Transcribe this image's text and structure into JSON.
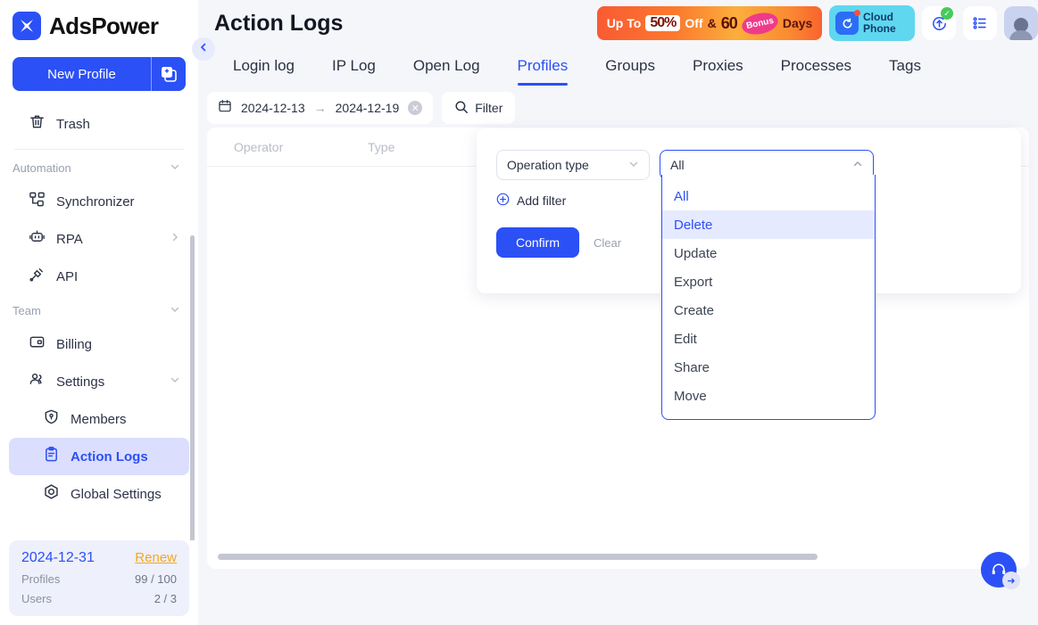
{
  "brand": {
    "name": "AdsPower",
    "logo_icon": "adspower-logo-icon"
  },
  "sidebar": {
    "new_profile_label": "New Profile",
    "new_profile_add_icon": "add-profile-icon",
    "items": [
      {
        "label": "Trash",
        "icon": "trash-icon",
        "type": "item"
      },
      {
        "label": "Automation",
        "icon": "chevron-down-icon",
        "type": "group"
      },
      {
        "label": "Synchronizer",
        "icon": "synchronizer-icon",
        "type": "item"
      },
      {
        "label": "RPA",
        "icon": "rpa-robot-icon",
        "type": "item",
        "chevron": "chevron-right-icon"
      },
      {
        "label": "API",
        "icon": "api-icon",
        "type": "item"
      },
      {
        "label": "Team",
        "icon": "chevron-down-icon",
        "type": "group"
      },
      {
        "label": "Billing",
        "icon": "billing-icon",
        "type": "item"
      },
      {
        "label": "Settings",
        "icon": "team-settings-icon",
        "type": "item",
        "chevron": "chevron-down-icon"
      },
      {
        "label": "Members",
        "icon": "members-shield-icon",
        "type": "sub"
      },
      {
        "label": "Action Logs",
        "icon": "action-logs-icon",
        "type": "sub",
        "active": true
      },
      {
        "label": "Global Settings",
        "icon": "global-settings-icon",
        "type": "sub"
      }
    ],
    "plan": {
      "expiry_date": "2024-12-31",
      "renew_label": "Renew",
      "rows": [
        {
          "key": "Profiles",
          "value": "99 / 100"
        },
        {
          "key": "Users",
          "value": "2 / 3"
        }
      ]
    },
    "collapse_icon": "chevron-left-icon"
  },
  "header": {
    "title": "Action Logs",
    "promo": {
      "up_to": "Up To",
      "percent": "50%",
      "off": "Off",
      "amp": "&",
      "days_count": "60",
      "bonus": "Bonus",
      "days": "Days"
    },
    "cloud_phone": {
      "line1": "Cloud",
      "line2": "Phone",
      "icon": "cloud-phone-icon"
    },
    "icons": [
      {
        "name": "update-icon",
        "badge": "check-badge"
      },
      {
        "name": "task-list-icon"
      },
      {
        "name": "avatar"
      }
    ]
  },
  "tabs": [
    {
      "label": "Login log",
      "active": false
    },
    {
      "label": "IP Log",
      "active": false
    },
    {
      "label": "Open Log",
      "active": false
    },
    {
      "label": "Profiles",
      "active": true
    },
    {
      "label": "Groups",
      "active": false
    },
    {
      "label": "Proxies",
      "active": false
    },
    {
      "label": "Processes",
      "active": false
    },
    {
      "label": "Tags",
      "active": false
    }
  ],
  "filter_bar": {
    "calendar_icon": "calendar-icon",
    "date_start": "2024-12-13",
    "date_arrow": "→",
    "date_end": "2024-12-19",
    "clear_icon": "clear-circle-icon",
    "search_icon": "search-icon",
    "filter_label": "Filter"
  },
  "table": {
    "columns": [
      "Operator",
      "Type"
    ],
    "rows": []
  },
  "filter_popover": {
    "field_label": "Operation type",
    "field_chevron": "chevron-down-icon",
    "value_label": "All",
    "value_chevron": "chevron-up-icon",
    "add_filter_label": "Add filter",
    "add_filter_icon": "plus-circle-icon",
    "confirm_label": "Confirm",
    "clear_label": "Clear",
    "dropdown_options": [
      {
        "label": "All",
        "state": "selected"
      },
      {
        "label": "Delete",
        "state": "highlight"
      },
      {
        "label": "Update",
        "state": "normal"
      },
      {
        "label": "Export",
        "state": "normal"
      },
      {
        "label": "Create",
        "state": "normal"
      },
      {
        "label": "Edit",
        "state": "normal"
      },
      {
        "label": "Share",
        "state": "normal"
      },
      {
        "label": "Move",
        "state": "normal"
      }
    ]
  },
  "support": {
    "icon": "headset-support-icon",
    "arrow_icon": "arrow-right-icon"
  },
  "colors": {
    "accent": "#2b50f6",
    "active_bg": "#dcdefd",
    "renew": "#f5a623",
    "page_bg": "#f5f6fa"
  }
}
